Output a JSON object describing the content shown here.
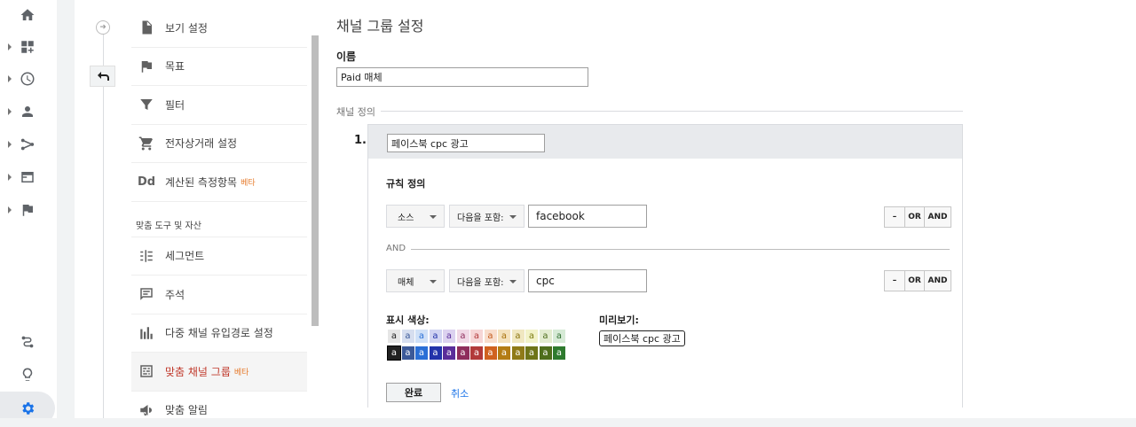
{
  "nav": {
    "items": [
      {
        "label": "보기 설정",
        "icon": "document-icon"
      },
      {
        "label": "목표",
        "icon": "flag-icon"
      },
      {
        "label": "필터",
        "icon": "filter-icon"
      },
      {
        "label": "전자상거래 설정",
        "icon": "cart-icon"
      },
      {
        "label": "계산된 측정항목",
        "icon": "dd-icon",
        "icon_text": "Dd",
        "badge": "베타"
      }
    ],
    "section_label": "맞춤 도구 및 자산",
    "tools": [
      {
        "label": "세그먼트",
        "icon": "segment-icon"
      },
      {
        "label": "주석",
        "icon": "annotation-icon"
      },
      {
        "label": "다중 채널 유입경로 설정",
        "icon": "bar-chart-icon"
      },
      {
        "label": "맞춤 채널 그룹",
        "icon": "channel-group-icon",
        "badge": "베타",
        "active": true
      },
      {
        "label": "맞춤 알림",
        "icon": "megaphone-icon"
      }
    ]
  },
  "page": {
    "title": "채널 그룹 설정",
    "name_label": "이름",
    "name_value": "Paid 매체",
    "definition_label": "채널 정의"
  },
  "channel": {
    "number": "1.",
    "name": "페이스북 cpc 광고",
    "rule_label": "규칙 정의",
    "rules": [
      {
        "dimension": "소스",
        "operator": "다음을 포함:",
        "value": "facebook"
      },
      {
        "dimension": "매체",
        "operator": "다음을 포함:",
        "value": "cpc"
      }
    ],
    "and_label": "AND",
    "buttons": {
      "minus": "–",
      "or": "OR",
      "and": "AND"
    },
    "color_label": "표시 색상:",
    "preview_label": "미리보기:",
    "preview_text": "페이스북 cpc 광고",
    "swatch_letter": "a",
    "done_label": "완료",
    "cancel_label": "취소"
  },
  "colors": {
    "light": [
      {
        "bg": "#e6e6e6",
        "fg": "#212121"
      },
      {
        "bg": "#d6deef",
        "fg": "#3b5998"
      },
      {
        "bg": "#cfe0f7",
        "fg": "#2a6fd6"
      },
      {
        "bg": "#d0d3f2",
        "fg": "#2233aa"
      },
      {
        "bg": "#dcd2f0",
        "fg": "#5a2d9a"
      },
      {
        "bg": "#f0d8e6",
        "fg": "#8e2d5c"
      },
      {
        "bg": "#f6d6d6",
        "fg": "#b23a3a"
      },
      {
        "bg": "#f8ddcc",
        "fg": "#c45a1c"
      },
      {
        "bg": "#f4e1bc",
        "fg": "#a8700c"
      },
      {
        "bg": "#f0e7c0",
        "fg": "#8a7410"
      },
      {
        "bg": "#f2f2c8",
        "fg": "#7a7a10"
      },
      {
        "bg": "#e2eccf",
        "fg": "#4e6e1c"
      },
      {
        "bg": "#d6ead6",
        "fg": "#2e6e2e"
      }
    ],
    "dark": [
      {
        "bg": "#212121",
        "fg": "#ffffff"
      },
      {
        "bg": "#3b5998",
        "fg": "#ffffff"
      },
      {
        "bg": "#2a6fd6",
        "fg": "#ffffff"
      },
      {
        "bg": "#2233aa",
        "fg": "#ffffff"
      },
      {
        "bg": "#5a2d9a",
        "fg": "#ffffff"
      },
      {
        "bg": "#8e2d5c",
        "fg": "#ffffff"
      },
      {
        "bg": "#b23a3a",
        "fg": "#ffffff"
      },
      {
        "bg": "#d0621f",
        "fg": "#ffffff"
      },
      {
        "bg": "#b47c14",
        "fg": "#ffffff"
      },
      {
        "bg": "#8f7a18",
        "fg": "#ffffff"
      },
      {
        "bg": "#6e7418",
        "fg": "#ffffff"
      },
      {
        "bg": "#4e6e1c",
        "fg": "#ffffff"
      },
      {
        "bg": "#2e7a2e",
        "fg": "#ffffff"
      }
    ]
  }
}
